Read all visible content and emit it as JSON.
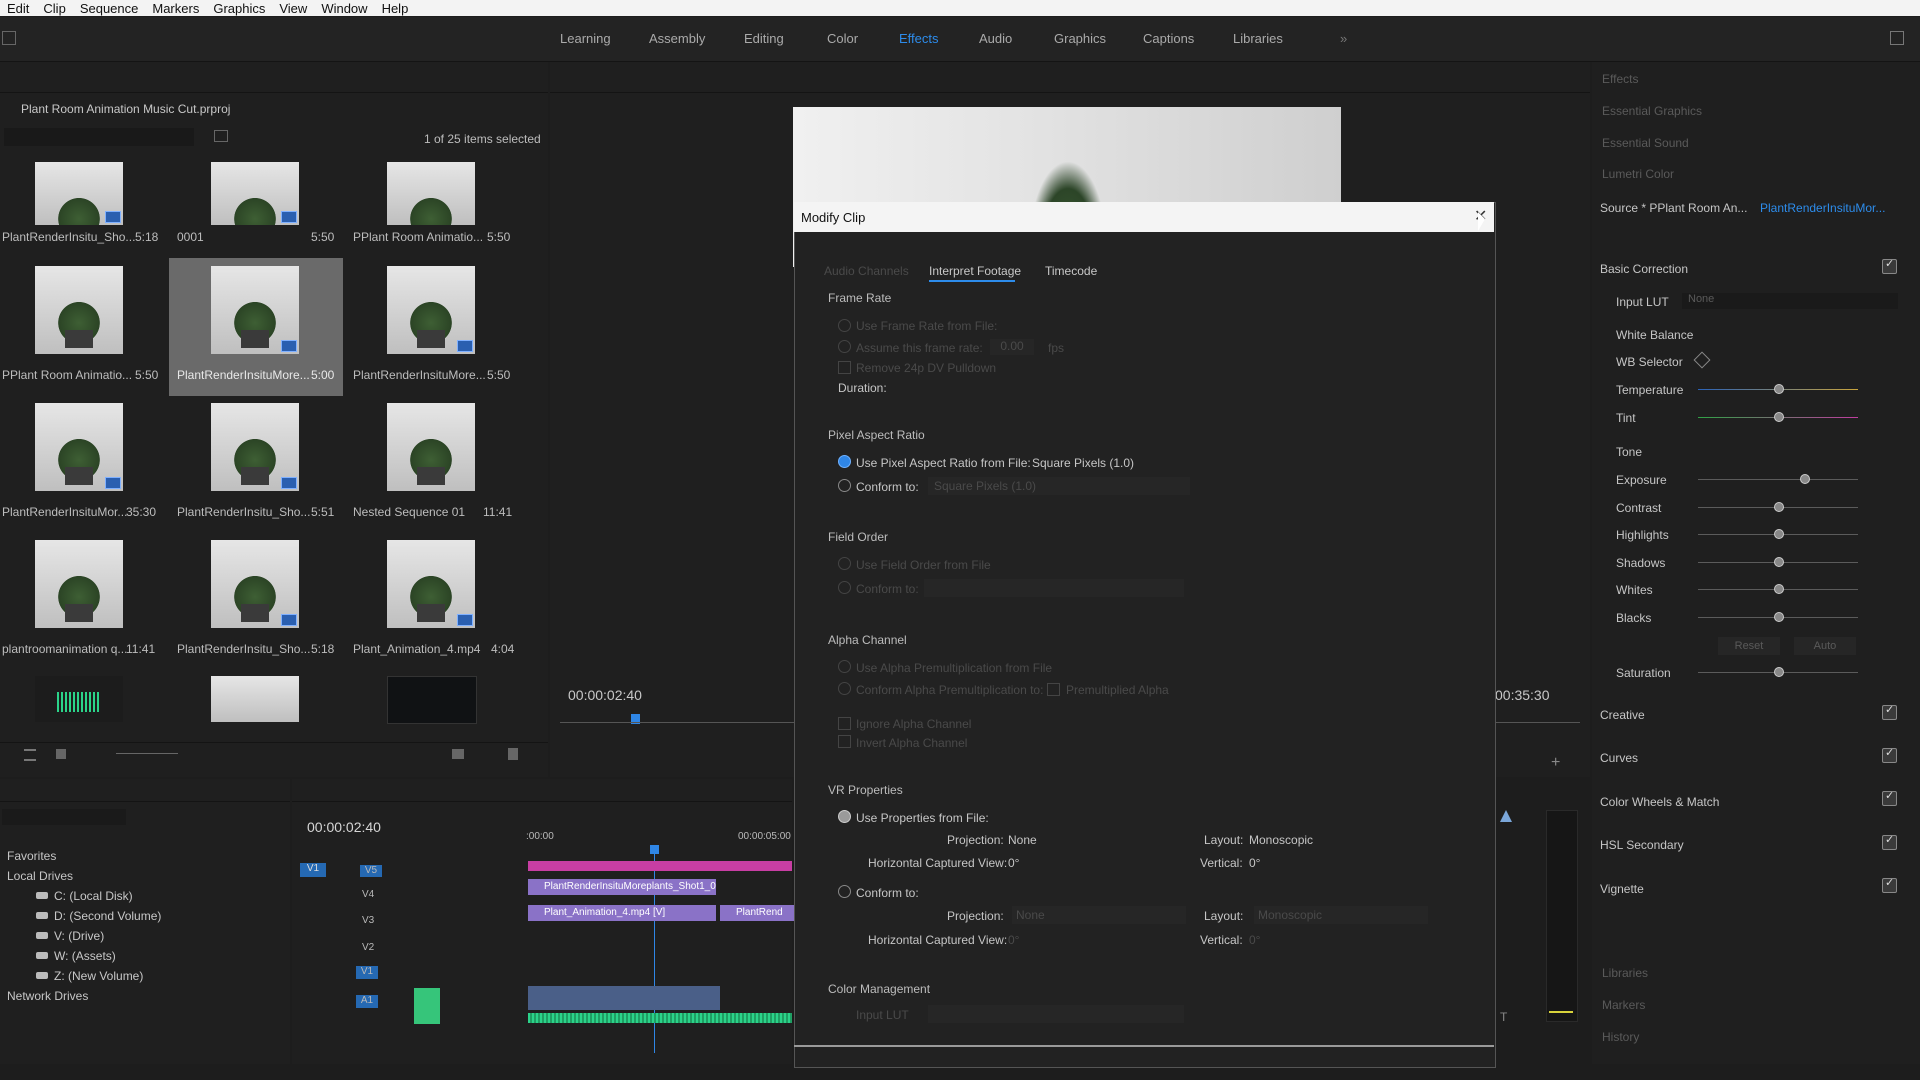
{
  "menu": [
    "Edit",
    "Clip",
    "Sequence",
    "Markers",
    "Graphics",
    "View",
    "Window",
    "Help"
  ],
  "workspaces": [
    {
      "label": "Learning",
      "active": false
    },
    {
      "label": "Assembly",
      "active": false
    },
    {
      "label": "Editing",
      "active": false
    },
    {
      "label": "Color",
      "active": false
    },
    {
      "label": "Effects",
      "active": true
    },
    {
      "label": "Audio",
      "active": false
    },
    {
      "label": "Graphics",
      "active": false
    },
    {
      "label": "Captions",
      "active": false
    },
    {
      "label": "Libraries",
      "active": false
    }
  ],
  "project": {
    "file": "Plant Room Animation Music Cut.prproj",
    "selection_count": "1 of 25 items selected",
    "items": [
      {
        "name": "PlantRenderInsitu_Sho...",
        "dur": "5:18"
      },
      {
        "name": "0001",
        "dur": "5:50"
      },
      {
        "name": "PPlant Room Animatio...",
        "dur": "5:50"
      },
      {
        "name": "PPlant Room Animatio...",
        "dur": "5:50"
      },
      {
        "name": "PlantRenderInsituMore...",
        "dur": "5:00",
        "selected": true
      },
      {
        "name": "PlantRenderInsituMore...",
        "dur": "5:50"
      },
      {
        "name": "PlantRenderInsituMor...",
        "dur": "35:30"
      },
      {
        "name": "PlantRenderInsitu_Sho...",
        "dur": "5:51"
      },
      {
        "name": "Nested Sequence 01",
        "dur": "11:41"
      },
      {
        "name": "plantroomanimation q...",
        "dur": "11:41"
      },
      {
        "name": "PlantRenderInsitu_Sho...",
        "dur": "5:18"
      },
      {
        "name": "Plant_Animation_4.mp4",
        "dur": "4:04"
      }
    ]
  },
  "media_browser": {
    "favorites": "Favorites",
    "local_drives": "Local Drives",
    "drives": [
      "C: (Local Disk)",
      "D: (Second Volume)",
      "V: (Drive)",
      "W: (Assets)",
      "Z: (New Volume)"
    ],
    "network": "Network Drives"
  },
  "program": {
    "timecode_left": "00:00:02:40",
    "timecode_right": "00:35:30"
  },
  "timeline": {
    "timecode": "00:00:02:40",
    "ruler_start": ":00:00",
    "ruler_end": "00:00:05:00",
    "tracks": [
      "V5",
      "V4",
      "V3",
      "V2",
      "V1",
      "A1"
    ],
    "source_patch": "V1",
    "clip_a": "PlantRenderInsituMoreplants_Shot1_0",
    "clip_b": "Plant_Animation_4.mp4 [V]",
    "clip_c": "PlantRend"
  },
  "modal": {
    "title": "Modify Clip",
    "tabs": [
      {
        "label": "Audio Channels",
        "active": false
      },
      {
        "label": "Interpret Footage",
        "active": true
      },
      {
        "label": "Timecode",
        "active": false
      }
    ],
    "frame_rate": {
      "heading": "Frame Rate",
      "opt1": "Use Frame Rate from File:",
      "opt2": "Assume this frame rate:",
      "opt2_value": "0.00",
      "opt2_unit": "fps",
      "opt3": "Remove 24p DV Pulldown",
      "duration": "Duration:"
    },
    "par": {
      "heading": "Pixel Aspect Ratio",
      "opt1": "Use Pixel Aspect Ratio from File:",
      "opt1_value": "Square Pixels (1.0)",
      "opt2": "Conform to:",
      "opt2_value": "Square Pixels (1.0)"
    },
    "field_order": {
      "heading": "Field Order",
      "opt1": "Use Field Order from File",
      "opt2": "Conform to:"
    },
    "alpha": {
      "heading": "Alpha Channel",
      "opt1": "Use Alpha Premultiplication from File",
      "opt2": "Conform Alpha Premultiplication to:",
      "opt2_check": "Premultiplied Alpha",
      "opt3": "Ignore Alpha Channel",
      "opt4": "Invert Alpha Channel"
    },
    "vr": {
      "heading": "VR Properties",
      "use_file": "Use Properties from File:",
      "projection_label": "Projection:",
      "projection_value": "None",
      "layout_label": "Layout:",
      "layout_value": "Monoscopic",
      "hcv_label": "Horizontal Captured View:",
      "hcv_value": "0°",
      "vertical_label": "Vertical:",
      "vertical_value": "0°",
      "conform": "Conform to:",
      "projection2_label": "Projection:",
      "projection2_value": "None",
      "layout2_label": "Layout:",
      "layout2_value": "Monoscopic",
      "hcv2_label": "Horizontal Captured View:",
      "hcv2_value": "0°",
      "vertical2_label": "Vertical:",
      "vertical2_value": "0°"
    },
    "color": {
      "heading": "Color Management",
      "input_lut": "Input LUT"
    }
  },
  "lumetri": {
    "effects": "Effects",
    "essential_graphics": "Essential Graphics",
    "essential_sound": "Essential Sound",
    "lumetri_color": "Lumetri Color",
    "source": "Source * PPlant Room An...",
    "target": "PlantRenderInsituMor...",
    "basic": "Basic Correction",
    "input_lut": "Input LUT",
    "input_lut_val": "None",
    "white_balance": "White Balance",
    "wb_selector": "WB Selector",
    "temperature": "Temperature",
    "tint": "Tint",
    "tone": "Tone",
    "exposure": "Exposure",
    "contrast": "Contrast",
    "highlights": "Highlights",
    "shadows": "Shadows",
    "whites": "Whites",
    "blacks": "Blacks",
    "reset": "Reset",
    "auto": "Auto",
    "saturation": "Saturation",
    "creative": "Creative",
    "curves": "Curves",
    "wheels": "Color Wheels & Match",
    "hsl": "HSL Secondary",
    "vignette": "Vignette",
    "libraries": "Libraries",
    "markers": "Markers",
    "history": "History"
  }
}
